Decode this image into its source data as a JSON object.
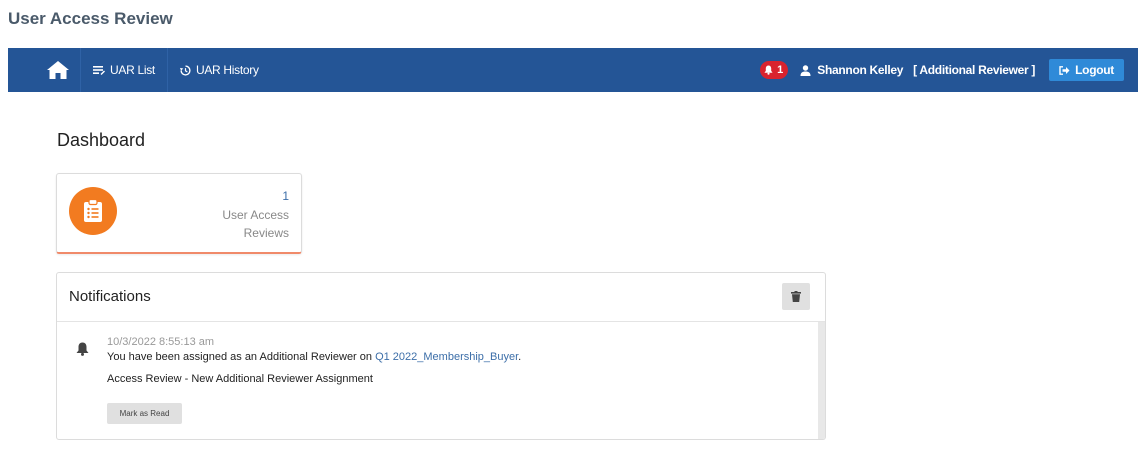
{
  "app": {
    "title": "User Access Review"
  },
  "navbar": {
    "home_icon": "home-icon",
    "items": [
      {
        "label": "UAR List",
        "icon": "list-edit-icon"
      },
      {
        "label": "UAR History",
        "icon": "history-icon"
      }
    ],
    "notification_count": "1",
    "user_name": "Shannon Kelley",
    "user_role": "[ Additional Reviewer ]",
    "logout_label": "Logout",
    "colors": {
      "bar": "#245596",
      "badge": "#d9232e",
      "logout": "#2f8ad8"
    }
  },
  "dashboard": {
    "heading": "Dashboard",
    "stat_card": {
      "count": "1",
      "label": "User Access Reviews",
      "icon": "clipboard-list-icon",
      "icon_color": "#f27b20"
    }
  },
  "notifications": {
    "title": "Notifications",
    "clear_icon": "trash-icon",
    "items": [
      {
        "timestamp": "10/3/2022 8:55:13 am",
        "message_prefix": "You have been assigned as an Additional Reviewer on ",
        "link_text": "Q1 2022_Membership_Buyer",
        "message_suffix": ".",
        "subtitle": "Access Review - New Additional Reviewer Assignment",
        "action_label": "Mark as Read"
      }
    ]
  }
}
